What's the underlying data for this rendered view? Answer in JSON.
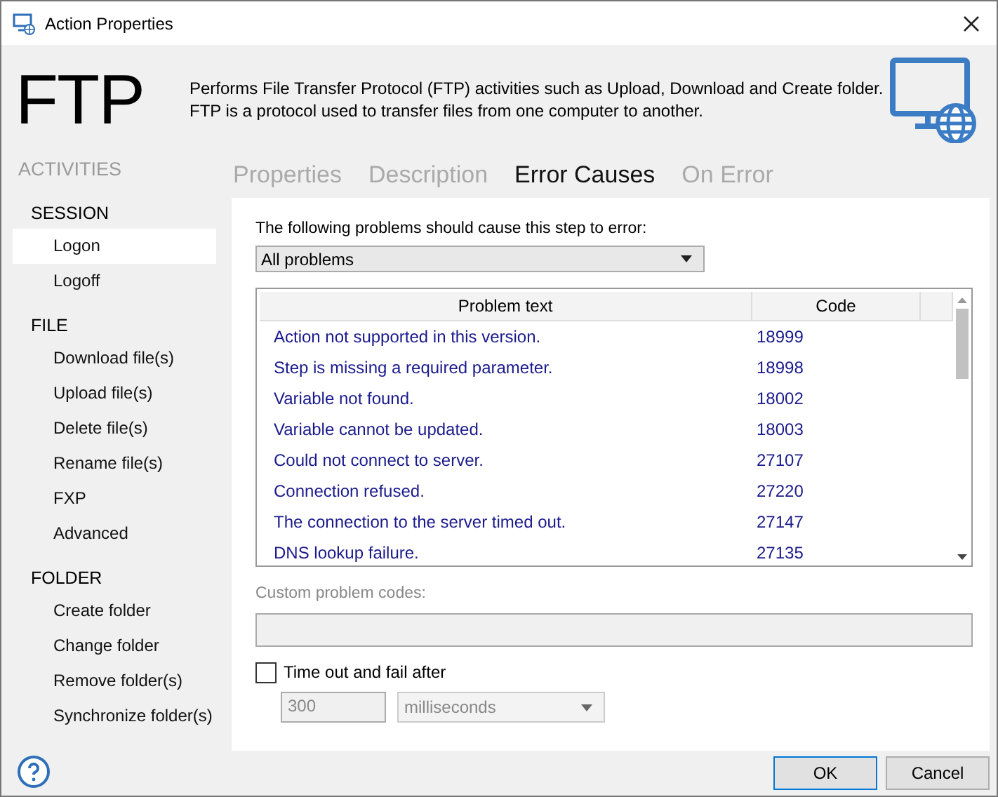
{
  "window": {
    "title": "Action Properties"
  },
  "header": {
    "title": "FTP",
    "description": [
      "Performs File Transfer Protocol (FTP) activities such as Upload, Download and Create folder.",
      "FTP is a protocol used to transfer files from one computer to another."
    ]
  },
  "sidebar": {
    "heading": "ACTIVITIES",
    "groups": [
      {
        "label": "SESSION",
        "items": [
          {
            "label": "Logon",
            "selected": true
          },
          {
            "label": "Logoff",
            "selected": false
          }
        ]
      },
      {
        "label": "FILE",
        "items": [
          {
            "label": "Download file(s)",
            "selected": false
          },
          {
            "label": "Upload file(s)",
            "selected": false
          },
          {
            "label": "Delete file(s)",
            "selected": false
          },
          {
            "label": "Rename file(s)",
            "selected": false
          },
          {
            "label": "FXP",
            "selected": false
          },
          {
            "label": "Advanced",
            "selected": false
          }
        ]
      },
      {
        "label": "FOLDER",
        "items": [
          {
            "label": "Create folder",
            "selected": false
          },
          {
            "label": "Change folder",
            "selected": false
          },
          {
            "label": "Remove folder(s)",
            "selected": false
          },
          {
            "label": "Synchronize folder(s)",
            "selected": false
          }
        ]
      }
    ]
  },
  "tabs": [
    {
      "label": "Properties",
      "selected": false
    },
    {
      "label": "Description",
      "selected": false
    },
    {
      "label": "Error Causes",
      "selected": true
    },
    {
      "label": "On Error",
      "selected": false
    }
  ],
  "error_causes": {
    "prompt": "The following problems should cause this step to error:",
    "problems_dropdown": {
      "value": "All problems"
    },
    "table": {
      "columns": [
        "Problem text",
        "Code"
      ],
      "rows": [
        {
          "problem": "Action not supported in this version.",
          "code": "18999"
        },
        {
          "problem": "Step is missing a required parameter.",
          "code": "18998"
        },
        {
          "problem": "Variable not found.",
          "code": "18002"
        },
        {
          "problem": "Variable cannot be updated.",
          "code": "18003"
        },
        {
          "problem": "Could not connect to server.",
          "code": "27107"
        },
        {
          "problem": "Connection refused.",
          "code": "27220"
        },
        {
          "problem": "The connection to the server timed out.",
          "code": "27147"
        },
        {
          "problem": "DNS lookup failure.",
          "code": "27135"
        }
      ]
    },
    "custom_codes": {
      "label": "Custom problem codes:",
      "disabled": true
    },
    "timeout": {
      "label": "Time out and fail after",
      "checked": false,
      "value": "300",
      "unit": "milliseconds"
    }
  },
  "buttons": [
    {
      "label": "OK",
      "default": true
    },
    {
      "label": "Cancel",
      "default": false
    }
  ]
}
